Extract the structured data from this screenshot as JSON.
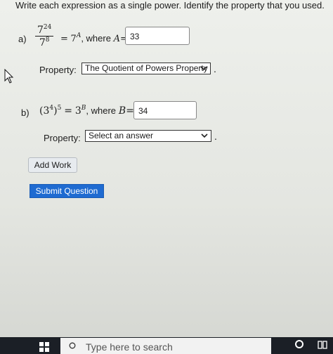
{
  "instruction": "Write each expression as a single power. Identify the property that you used.",
  "part_a": {
    "label": "a)",
    "numerator_base": "7",
    "numerator_exp": "24",
    "denominator_base": "7",
    "denominator_exp": "8",
    "rhs_base": "7",
    "rhs_exp": "A",
    "where_text": ", where",
    "var": "A",
    "equals": "=",
    "answer": "33",
    "property_label": "Property:",
    "property_selected": "The Quotient of Powers Property",
    "period": "."
  },
  "part_b": {
    "label": "b)",
    "inner_base": "3",
    "inner_exp": "4",
    "outer_exp": "5",
    "rhs_base": "3",
    "rhs_exp": "B",
    "where_text": ", where",
    "var": "B",
    "equals": "=",
    "answer": "34",
    "property_label": "Property:",
    "property_selected": "Select an answer",
    "period": "."
  },
  "buttons": {
    "add_work": "Add Work",
    "submit": "Submit Question"
  },
  "taskbar": {
    "search_placeholder": "Type here to search"
  },
  "colors": {
    "submit_bg": "#1f6bd1",
    "taskbar_bg": "#1b1f26"
  }
}
